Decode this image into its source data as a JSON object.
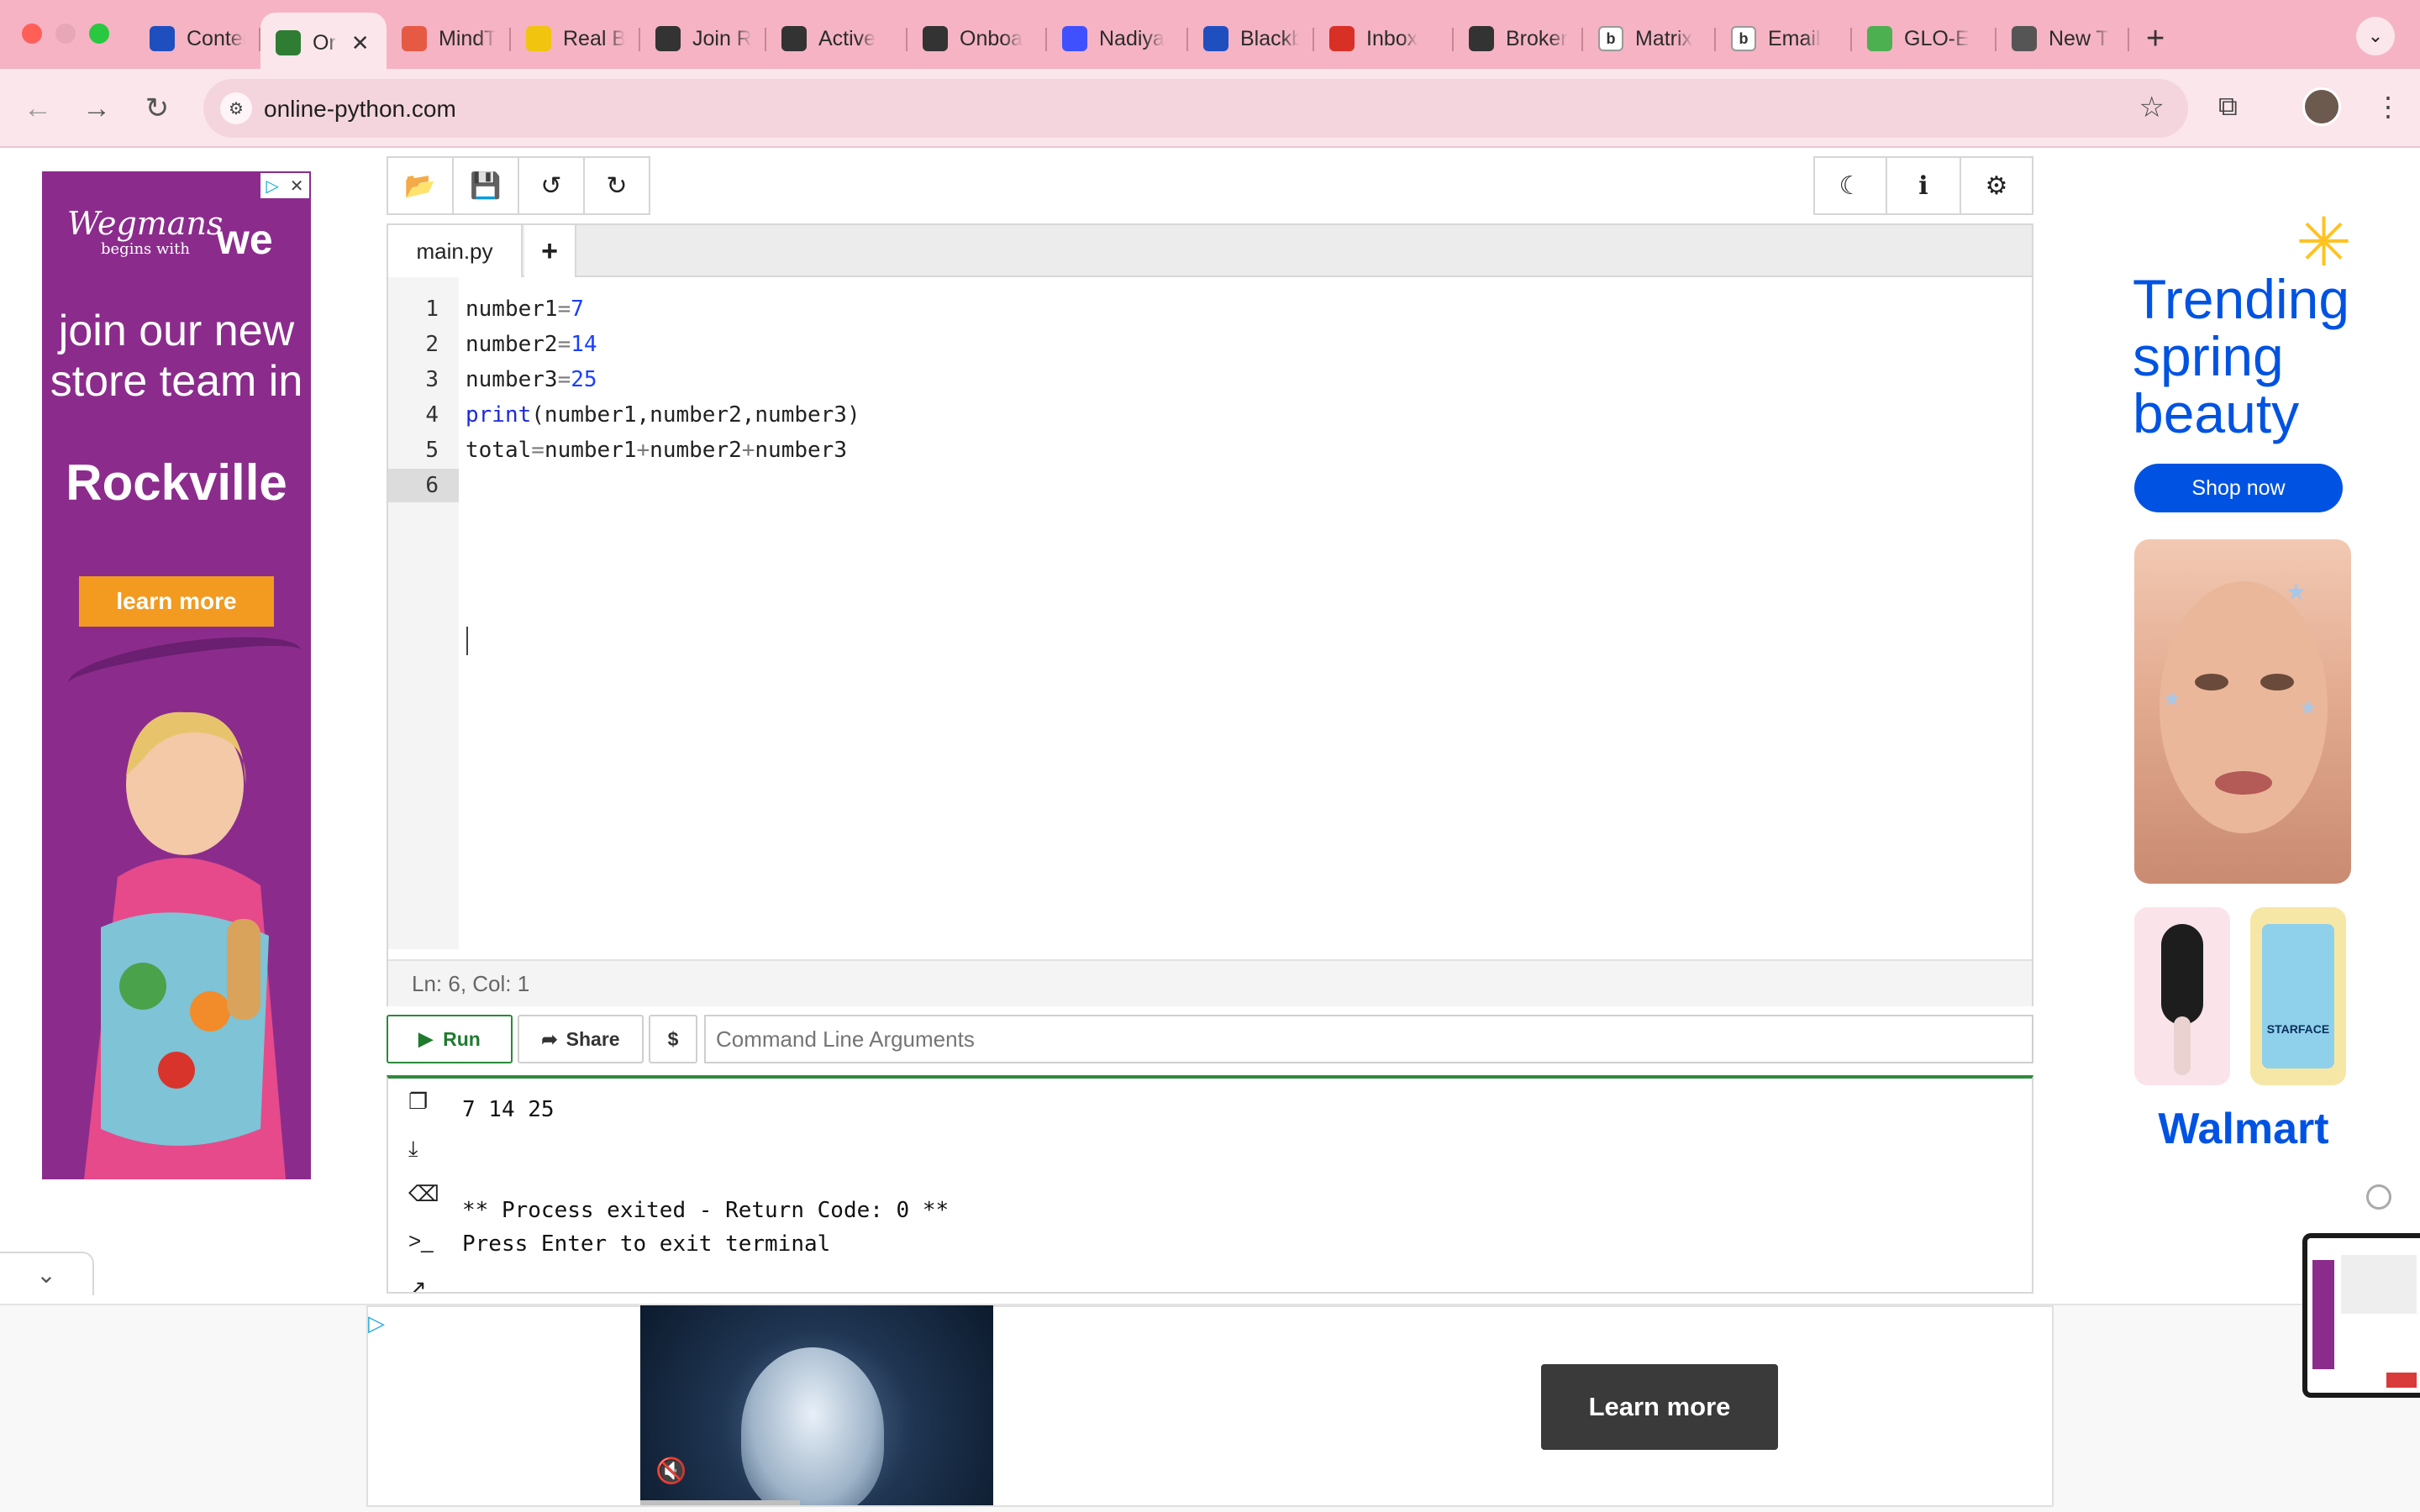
{
  "browser": {
    "tabs": [
      {
        "title": "Conter",
        "icon": "a-icon",
        "color": "#1f4fbf"
      },
      {
        "title": "Or",
        "icon": "shield-icon",
        "color": "#2e7d32",
        "active": true
      },
      {
        "title": "MindT",
        "icon": "mind-icon",
        "color": "#e65a44"
      },
      {
        "title": "Real B",
        "icon": "d-icon",
        "color": "#f1c40f"
      },
      {
        "title": "Join R",
        "icon": "bracket-icon",
        "color": "#333333"
      },
      {
        "title": "Active",
        "icon": "bracket-icon",
        "color": "#333333"
      },
      {
        "title": "Onboa",
        "icon": "bracket-icon",
        "color": "#333333"
      },
      {
        "title": "Nadiya",
        "icon": "k-icon",
        "color": "#3f51ff"
      },
      {
        "title": "Blackb",
        "icon": "a-icon",
        "color": "#1f4fbf"
      },
      {
        "title": "Inbox",
        "icon": "gmail-icon",
        "color": "#d93025"
      },
      {
        "title": "Broker",
        "icon": "openai-icon",
        "color": "#333333"
      },
      {
        "title": "Matrix",
        "icon": "b-icon",
        "color": "#ffffff"
      },
      {
        "title": "Email",
        "icon": "b-icon",
        "color": "#ffffff"
      },
      {
        "title": "GLO-E",
        "icon": "globe-icon",
        "color": "#4caf50"
      },
      {
        "title": "New T",
        "icon": "chrome-icon",
        "color": "#555555"
      }
    ],
    "close_glyph": "✕",
    "new_tab_glyph": "+",
    "url": "online-python.com"
  },
  "ide": {
    "file_tab": "main.py",
    "add_file_glyph": "+",
    "lines": [
      {
        "n": "1",
        "tokens": [
          [
            "t",
            "number1"
          ],
          [
            "op",
            "="
          ],
          [
            "num",
            "7"
          ]
        ]
      },
      {
        "n": "2",
        "tokens": [
          [
            "t",
            "number2"
          ],
          [
            "op",
            "="
          ],
          [
            "num",
            "14"
          ]
        ]
      },
      {
        "n": "3",
        "tokens": [
          [
            "t",
            "number3"
          ],
          [
            "op",
            "="
          ],
          [
            "num",
            "25"
          ]
        ]
      },
      {
        "n": "4",
        "tokens": [
          [
            "kw",
            "print"
          ],
          [
            "t",
            "(number1,number2,number3)"
          ]
        ]
      },
      {
        "n": "5",
        "tokens": [
          [
            "t",
            "total"
          ],
          [
            "op",
            "="
          ],
          [
            "t",
            "number1"
          ],
          [
            "op",
            "+"
          ],
          [
            "t",
            "number2"
          ],
          [
            "op",
            "+"
          ],
          [
            "t",
            "number3"
          ]
        ]
      },
      {
        "n": "6",
        "tokens": []
      }
    ],
    "status": "Ln: 6,  Col: 1",
    "run_label": "Run",
    "share_label": "Share",
    "dollar_label": "$",
    "args_placeholder": "Command Line Arguments",
    "console": {
      "lines": [
        "7 14 25",
        "",
        "",
        "** Process exited - Return Code: 0 **",
        "Press Enter to exit terminal"
      ]
    }
  },
  "ads": {
    "left": {
      "brand": "Wegmans",
      "tagline": "begins with",
      "we": "we",
      "headline": "join our new store team in",
      "city": "Rockville",
      "cta": "learn more"
    },
    "right": {
      "headline": "Trending spring beauty",
      "cta": "Shop now",
      "logo": "Walmart"
    },
    "bottom": {
      "cta": "Learn more"
    }
  },
  "colors": {
    "tabbar": "#f5b3c4",
    "accent_green": "#2e8b3e",
    "walmart_blue": "#0053e2",
    "wegmans_purple": "#8b2c8c"
  }
}
